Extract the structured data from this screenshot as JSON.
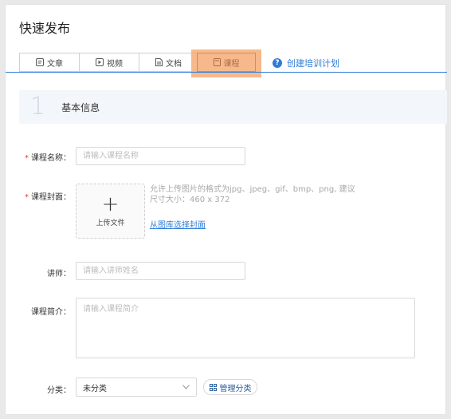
{
  "page": {
    "title": "快速发布"
  },
  "tabs": [
    {
      "label": "文章",
      "icon": "article-icon"
    },
    {
      "label": "视频",
      "icon": "video-icon"
    },
    {
      "label": "文档",
      "icon": "document-icon"
    },
    {
      "label": "课程",
      "icon": "course-icon",
      "active": true
    }
  ],
  "plan_link": {
    "label": "创建培训计划",
    "help_glyph": "?"
  },
  "section": {
    "number": "1",
    "title": "基本信息"
  },
  "form": {
    "course_name": {
      "label": "课程名称：",
      "placeholder": "请输入课程名称"
    },
    "course_cover": {
      "label": "课程封面：",
      "upload_label": "上传文件",
      "hint": "允许上传图片的格式为jpg、jpeg、gif、bmp、png, 建议尺寸大小：460 x 372",
      "library_link": "从图库选择封面"
    },
    "lecturer": {
      "label": "讲师：",
      "placeholder": "请输入讲师姓名"
    },
    "intro": {
      "label": "课程简介：",
      "placeholder": "请输入课程简介"
    },
    "category": {
      "label": "分类：",
      "value": "未分类",
      "manage_label": "管理分类"
    }
  },
  "colors": {
    "accent": "#2f7cd8",
    "required": "#e33b3b",
    "highlight": "#f6ad78"
  }
}
